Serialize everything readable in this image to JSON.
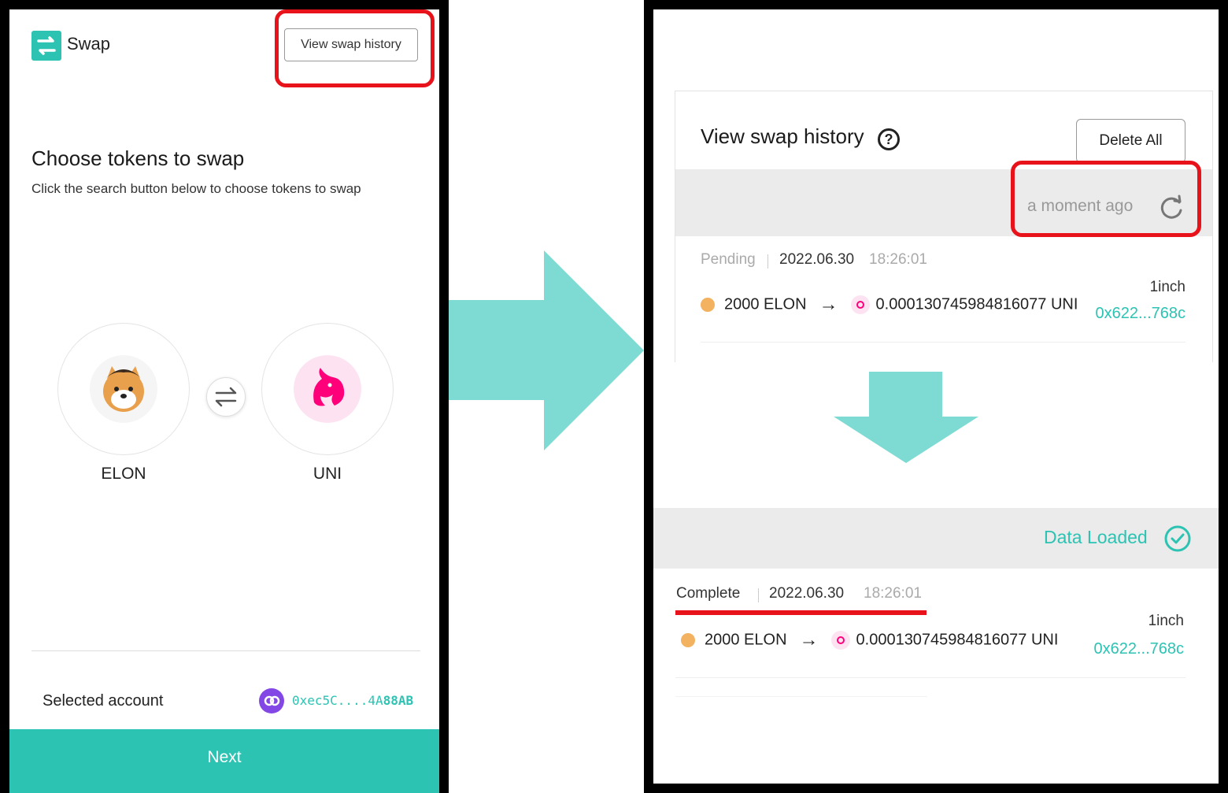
{
  "left": {
    "app_title": "Swap",
    "history_button": "View swap history",
    "heading": "Choose tokens to swap",
    "subheading": "Click the search button below to choose tokens to swap",
    "from_token": "ELON",
    "to_token": "UNI",
    "from_token_icon": "elon-shiba-icon",
    "to_token_icon": "uniswap-unicorn-icon",
    "account_label": "Selected account",
    "account_address_prefix": "0xec5C....4A",
    "account_address_suffix": "88AB",
    "next_button": "Next"
  },
  "right": {
    "title": "View swap history",
    "delete_all": "Delete All",
    "refresh_text": "a moment ago",
    "loaded_text": "Data Loaded",
    "pending_row": {
      "status": "Pending",
      "date": "2022.06.30",
      "time": "18:26:01",
      "from": "2000 ELON",
      "to": "0.000130745984816077 UNI",
      "exchange": "1inch",
      "tx": "0x622...768c"
    },
    "complete_row": {
      "status": "Complete",
      "date": "2022.06.30",
      "time": "18:26:01",
      "from": "2000 ELON",
      "to": "0.000130745984816077 UNI",
      "exchange": "1inch",
      "tx": "0x622...768c"
    }
  },
  "colors": {
    "accent": "#2cc3b3",
    "highlight": "#e8131a",
    "arrow": "#7ddbd3",
    "polygon": "#8247e5"
  }
}
